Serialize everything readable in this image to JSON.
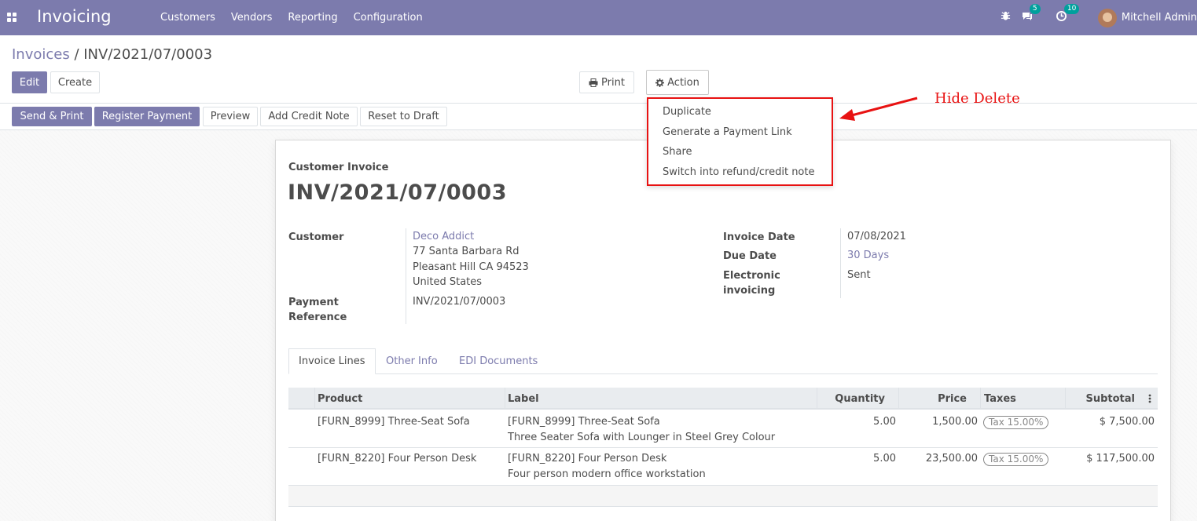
{
  "navbar": {
    "app_title": "Invoicing",
    "menu": [
      "Customers",
      "Vendors",
      "Reporting",
      "Configuration"
    ],
    "messages_count": "5",
    "activities_count": "10",
    "user_name": "Mitchell Admin"
  },
  "breadcrumb": {
    "parent": "Invoices",
    "separator": " / ",
    "current": "INV/2021/07/0003"
  },
  "buttons": {
    "edit": "Edit",
    "create": "Create",
    "print": "Print",
    "action": "Action",
    "send_print": "Send & Print",
    "register_payment": "Register Payment",
    "preview": "Preview",
    "add_credit_note": "Add Credit Note",
    "reset_to_draft": "Reset to Draft"
  },
  "action_menu": [
    "Duplicate",
    "Generate a Payment Link",
    "Share",
    "Switch into refund/credit note"
  ],
  "annotation": "Hide Delete",
  "colors": {
    "brand": "#7c7bad",
    "annotation": "#e81212",
    "badge": "#00a09d"
  },
  "invoice": {
    "type": "Customer Invoice",
    "name": "INV/2021/07/0003",
    "customer_label": "Customer",
    "customer_name": "Deco Addict",
    "address_line1": "77 Santa Barbara Rd",
    "address_line2": "Pleasant Hill CA 94523",
    "address_line3": "United States",
    "payment_ref_label_1": "Payment",
    "payment_ref_label_2": "Reference",
    "payment_ref": "INV/2021/07/0003",
    "invoice_date_label": "Invoice Date",
    "invoice_date": "07/08/2021",
    "due_date_label": "Due Date",
    "due_date": "30 Days",
    "einv_label_1": "Electronic",
    "einv_label_2": "invoicing",
    "einv_value": "Sent"
  },
  "tabs": [
    "Invoice Lines",
    "Other Info",
    "EDI Documents"
  ],
  "table": {
    "headers": [
      "Product",
      "Label",
      "Quantity",
      "Price",
      "Taxes",
      "Subtotal"
    ],
    "rows": [
      {
        "product": "[FURN_8999] Three-Seat Sofa",
        "label_1": "[FURN_8999] Three-Seat Sofa",
        "label_2": "Three Seater Sofa with Lounger in Steel Grey Colour",
        "quantity": "5.00",
        "price": "1,500.00",
        "tax": "Tax 15.00%",
        "subtotal": "$ 7,500.00"
      },
      {
        "product": "[FURN_8220] Four Person Desk",
        "label_1": "[FURN_8220] Four Person Desk",
        "label_2": "Four person modern office workstation",
        "quantity": "5.00",
        "price": "23,500.00",
        "tax": "Tax 15.00%",
        "subtotal": "$ 117,500.00"
      }
    ]
  }
}
